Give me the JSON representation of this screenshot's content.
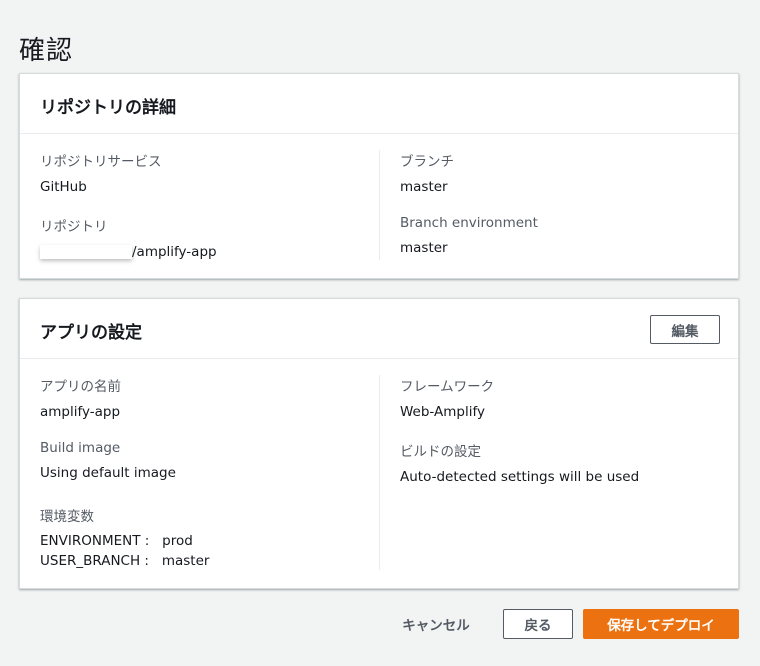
{
  "page": {
    "title": "確認"
  },
  "repo_panel": {
    "title": "リポジトリの詳細",
    "service_label": "リポジトリサービス",
    "service_value": "GitHub",
    "repo_label": "リポジトリ",
    "repo_value": "/amplify-app",
    "branch_label": "ブランチ",
    "branch_value": "master",
    "env_label": "Branch environment",
    "env_value": "master"
  },
  "app_panel": {
    "title": "アプリの設定",
    "edit_label": "編集",
    "name_label": "アプリの名前",
    "name_value": "amplify-app",
    "image_label": "Build image",
    "image_value": "Using default image",
    "envvars_label": "環境変数",
    "envvars": [
      "ENVIRONMENT :   prod",
      "USER_BRANCH :   master"
    ],
    "framework_label": "フレームワーク",
    "framework_value": "Web-Amplify",
    "build_label": "ビルドの設定",
    "build_value": "Auto-detected settings will be used"
  },
  "footer": {
    "cancel_label": "キャンセル",
    "back_label": "戻る",
    "deploy_label": "保存してデプロイ"
  },
  "colors": {
    "primary": "#ec7211",
    "background": "#f2f3f3",
    "label": "#545b64"
  }
}
